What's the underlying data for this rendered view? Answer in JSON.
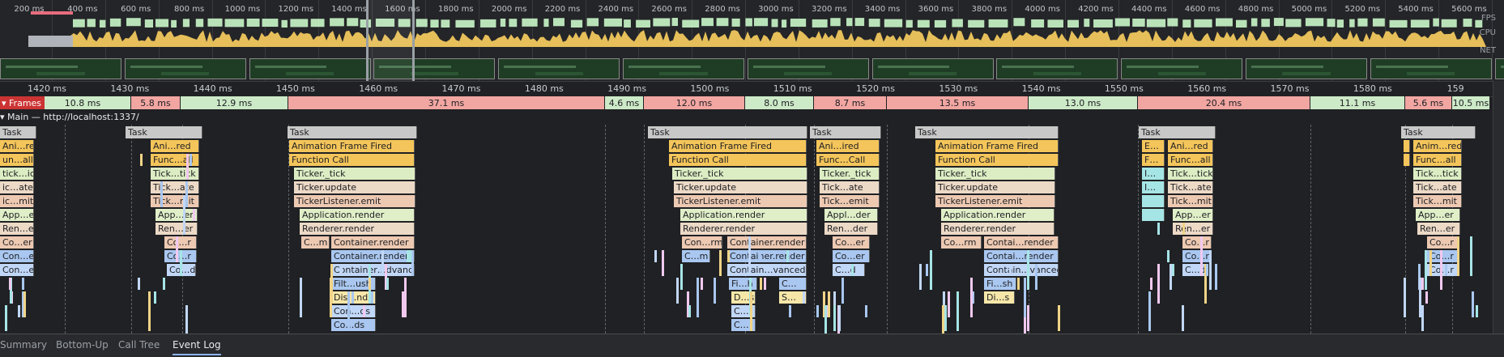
{
  "overview": {
    "ticks": [
      "200 ms",
      "400 ms",
      "600 ms",
      "800 ms",
      "1000 ms",
      "1200 ms",
      "1400 ms",
      "1600 ms",
      "1800 ms",
      "2000 ms",
      "2200 ms",
      "2400 ms",
      "2600 ms",
      "2800 ms",
      "3000 ms",
      "3200 ms",
      "3400 ms",
      "3600 ms",
      "3800 ms",
      "4000 ms",
      "4200 ms",
      "4400 ms",
      "4600 ms",
      "4800 ms",
      "5000 ms",
      "5200 ms",
      "5400 ms",
      "5600 ms"
    ],
    "labels": {
      "fps": "FPS",
      "cpu": "CPU",
      "net": "NET"
    }
  },
  "ruler": {
    "ticks": [
      "1420 ms",
      "1430 ms",
      "1440 ms",
      "1450 ms",
      "1460 ms",
      "1470 ms",
      "1480 ms",
      "1490 ms",
      "1500 ms",
      "1510 ms",
      "1520 ms",
      "1530 ms",
      "1540 ms",
      "1550 ms",
      "1560 ms",
      "1570 ms",
      "1580 ms",
      "159"
    ]
  },
  "frames": {
    "label": "Frames",
    "items": [
      {
        "text": "10.8 ms",
        "status": "good"
      },
      {
        "text": "5.8 ms",
        "status": "long"
      },
      {
        "text": "12.9 ms",
        "status": "good"
      },
      {
        "text": "37.1 ms",
        "status": "long"
      },
      {
        "text": "4.6 ms",
        "status": "good"
      },
      {
        "text": "12.0 ms",
        "status": "long"
      },
      {
        "text": "8.0 ms",
        "status": "good"
      },
      {
        "text": "8.7 ms",
        "status": "long"
      },
      {
        "text": "13.5 ms",
        "status": "long"
      },
      {
        "text": "13.0 ms",
        "status": "good"
      },
      {
        "text": "20.4 ms",
        "status": "long"
      },
      {
        "text": "11.1 ms",
        "status": "good"
      },
      {
        "text": "5.6 ms",
        "status": "long"
      },
      {
        "text": "10.5 ms",
        "status": "good"
      }
    ]
  },
  "main": {
    "title": "Main — http://localhost:1337/"
  },
  "flame": {
    "task_label": "Task",
    "col0": [
      "Ani…red",
      "un…all",
      "tick…ick",
      "ic…ate",
      "ic…mit",
      "App…er",
      "Ren…er",
      "Co…er",
      "Con…er",
      "Con…ed"
    ],
    "col1": [
      "Ani…red",
      "Func…all",
      "Tick…tick",
      "Tick…ate",
      "Tick…mit",
      "App…er",
      "Ren…er",
      "Co…r",
      "Co…r",
      "Co…d"
    ],
    "col2": [
      "Animation Frame Fired",
      "Function Call",
      "Ticker._tick",
      "Ticker.update",
      "TickerListener.emit",
      "Application.render",
      "Renderer.render",
      "C…m",
      "Container.render",
      "Container.render",
      "Container…dvanced",
      "Filt…ush",
      "Dis…nds",
      "Con…ds",
      "Co…ds"
    ],
    "col3": [
      "Animation Frame Fired",
      "Function Call",
      "Ticker._tick",
      "Ticker.update",
      "TickerListener.emit",
      "Application.render",
      "Renderer.render",
      "Con…rm",
      "Container.render",
      "C…m",
      "Container.render",
      "Contain…vanced",
      "Fi…h",
      "C…",
      "D…s",
      "S…",
      "C…",
      "C…"
    ],
    "col4": [
      "Ani…ired",
      "Func…Call",
      "Ticker._tick",
      "Tick…ate",
      "Tick…emit",
      "Appl…der",
      "Ren…der",
      "Co…er",
      "Co…er",
      "C…d"
    ],
    "col5": [
      "Animation Frame Fired",
      "Function Call",
      "Ticker._tick",
      "Ticker.update",
      "TickerListener.emit",
      "Application.render",
      "Renderer.render",
      "Co…rm",
      "Contai…render",
      "Contai…render",
      "Contain…vanced",
      "Fi…sh",
      "Di…s"
    ],
    "col6a": [
      "E…",
      "F…",
      "I…",
      "I…"
    ],
    "col6": [
      "Ani…red",
      "Func…all",
      "Tick…tick",
      "Tick…ate",
      "Tick…mit",
      "App…er",
      "Ren…er",
      "Co…r",
      "Co…r",
      "C…d"
    ],
    "col7": [
      "Anim…red",
      "Func…all",
      "Tick…tick",
      "Tick…ate",
      "Tick…mit",
      "App…er",
      "Ren…er",
      "Co…r",
      "Co…r",
      "Co…r"
    ]
  },
  "tabs": [
    "Summary",
    "Bottom-Up",
    "Call Tree",
    "Event Log"
  ],
  "active_tab": "Event Log"
}
